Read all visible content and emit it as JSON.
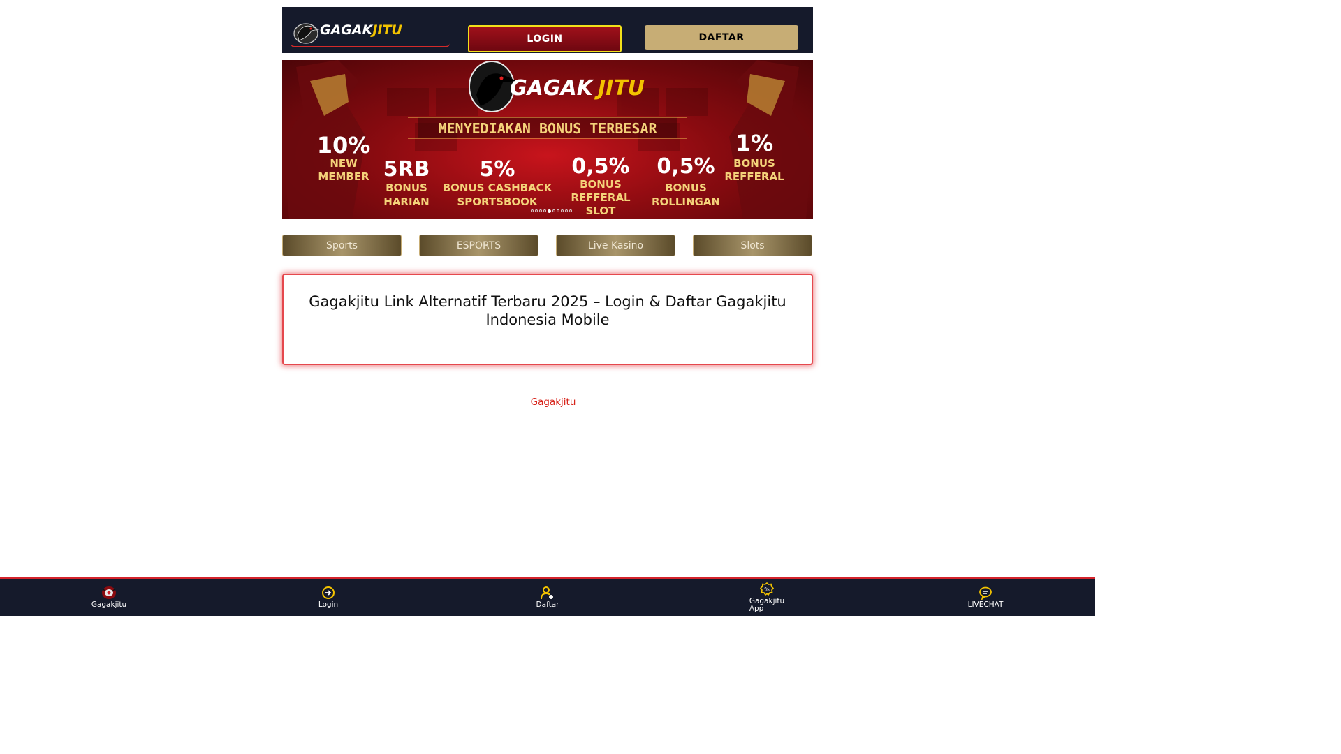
{
  "header": {
    "logo_text_white": "GAGAK",
    "logo_text_yellow": "JITU",
    "login_label": "LOGIN",
    "daftar_label": "DAFTAR"
  },
  "banner": {
    "brand_white": "GAGAK",
    "brand_yellow": "JITU",
    "headline": "MENYEDIAKAN BONUS TERBESAR",
    "promos": [
      {
        "value": "10%",
        "line1": "NEW",
        "line2": "MEMBER"
      },
      {
        "value": "5RB",
        "line1": "BONUS",
        "line2": "HARIAN"
      },
      {
        "value": "5%",
        "line1": "BONUS CASHBACK",
        "line2": "SPORTSBOOK"
      },
      {
        "value": "0,5%",
        "line1": "BONUS",
        "line2": "REFFERAL",
        "line3": "SLOT"
      },
      {
        "value": "0,5%",
        "line1": "BONUS",
        "line2": "ROLLINGAN"
      },
      {
        "value": "1%",
        "line1": "BONUS",
        "line2": "REFFERAL"
      }
    ],
    "slide_count": 10,
    "active_slide": 4
  },
  "categories": [
    "Sports",
    "ESPORTS",
    "Live Kasino",
    "Slots"
  ],
  "card": {
    "title": "Gagakjitu Link Alternatif Terbaru 2025 – Login & Daftar Gagakjitu Indonesia Mobile"
  },
  "footer_link": "Gagakjitu",
  "bottom_nav": [
    {
      "label": "Gagakjitu",
      "icon": "home-logo-icon"
    },
    {
      "label": "Login",
      "icon": "login-arrow-icon"
    },
    {
      "label": "Daftar",
      "icon": "add-user-icon"
    },
    {
      "label": "Gagakjitu\nApp",
      "icon": "promo-badge-icon"
    },
    {
      "label": "LIVECHAT",
      "icon": "chat-icon"
    }
  ],
  "colors": {
    "header_bg": "#151a2b",
    "accent_red": "#d4232b",
    "gold": "#c7ad75",
    "brand_yellow": "#f3c300"
  }
}
